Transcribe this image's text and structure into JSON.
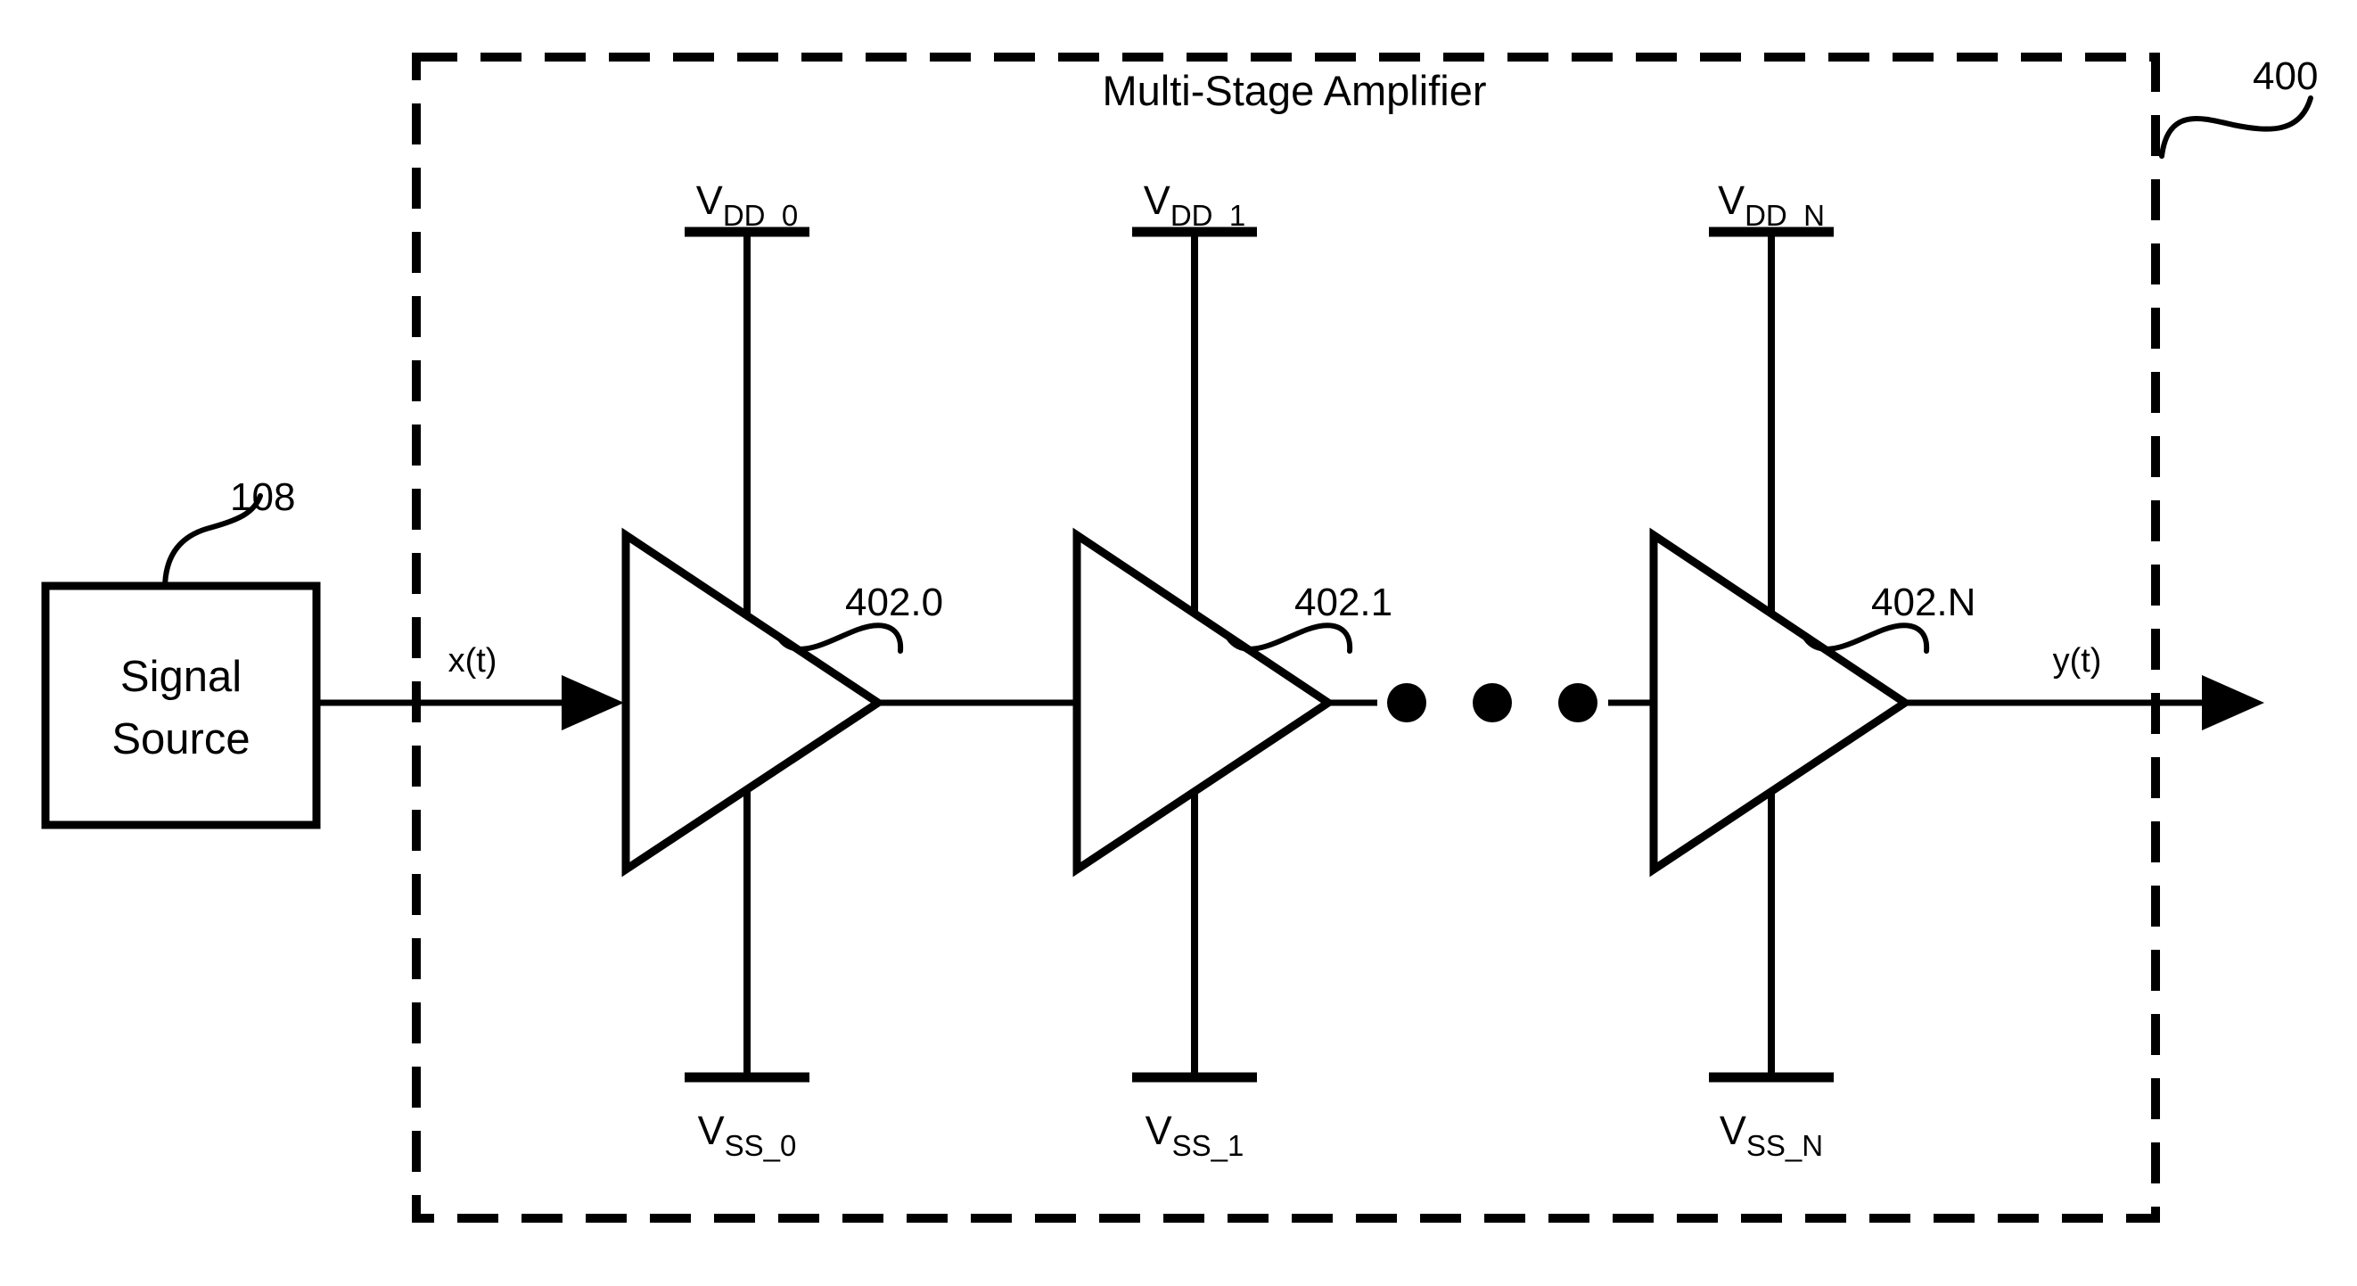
{
  "figure": {
    "reference_numeral": "400",
    "enclosure_title": "Multi-Stage Amplifier"
  },
  "signal_source": {
    "line1": "Signal",
    "line2": "Source",
    "reference_numeral": "108"
  },
  "signals": {
    "input_label": "x(t)",
    "output_label": "y(t)"
  },
  "ellipsis": {
    "dot_count": 3
  },
  "stages": [
    {
      "reference_numeral": "402.0",
      "vdd_symbol": "V",
      "vdd_subscript": "DD_0",
      "vss_symbol": "V",
      "vss_subscript": "SS_0"
    },
    {
      "reference_numeral": "402.1",
      "vdd_symbol": "V",
      "vdd_subscript": "DD_1",
      "vss_symbol": "V",
      "vss_subscript": "SS_1"
    },
    {
      "reference_numeral": "402.N",
      "vdd_symbol": "V",
      "vdd_subscript": "DD_N",
      "vss_symbol": "V",
      "vss_subscript": "SS_N"
    }
  ],
  "colors": {
    "line": "#000000",
    "background": "#ffffff"
  }
}
